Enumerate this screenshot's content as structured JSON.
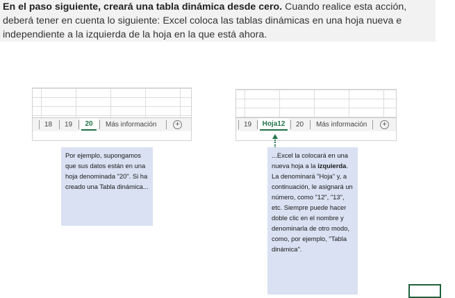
{
  "intro": {
    "bold_text": "En el paso siguiente, creará una tabla dinámica desde cero.",
    "text": " Cuando realice esta acción, deberá tener en cuenta lo siguiente: Excel coloca las tablas dinámicas en una hoja nueva e independiente a la izquierda de la hoja en la que está ahora."
  },
  "left_sheet": {
    "tabs": [
      "18",
      "19",
      "20"
    ],
    "active_tab": "20",
    "more": "Más información",
    "add": "⊕"
  },
  "right_sheet": {
    "tabs": [
      "19",
      "Hoja12",
      "20"
    ],
    "active_tab": "Hoja12",
    "more": "Más información",
    "add": "⊕"
  },
  "left_note": "Por ejemplo, supongamos que sus datos están en una hoja denominada \"20\". Si ha creado una Tabla dinámica...",
  "right_note": {
    "part1": "...Excel la colocará en una nueva hoja a la ",
    "bold": "izquierda",
    "part2": ". La denominará \"Hoja\" y, a continuación, le asignará un número, como \"12\", \"13\", etc. Siempre puede hacer doble clic en el nombre y denominarla de otro modo, como, por ejemplo, \"Tabla dinámica\"."
  },
  "colors": {
    "excel_green": "#217346",
    "note_bg": "#d9e1f2",
    "banner_bg": "#f2f2f2"
  }
}
